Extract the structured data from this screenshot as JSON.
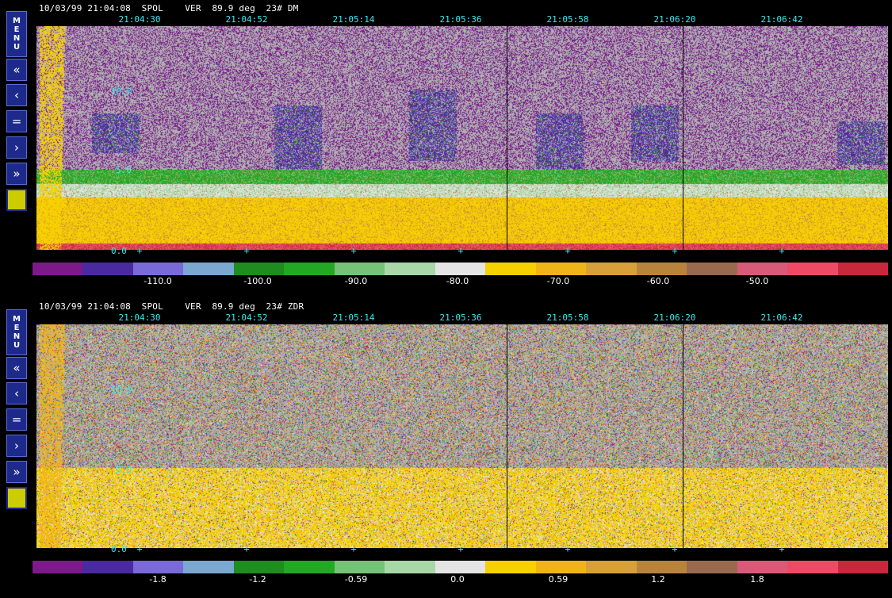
{
  "panels": [
    {
      "header": "10/03/99 21:04:08  SPOL    VER  89.9 deg  23# DM",
      "times": [
        "21:04:30",
        "21:04:52",
        "21:05:14",
        "21:05:36",
        "21:05:58",
        "21:06:20",
        "21:06:42"
      ],
      "alt_labels": [
        "10.0",
        "5.0"
      ],
      "zero_label": "0.0",
      "colorbar_labels": [
        "-110.0",
        "-100.0",
        "-90.0",
        "-80.0",
        "-70.0",
        "-60.0",
        "-50.0"
      ],
      "colorbar_colors": [
        "#7c1a8a",
        "#4a2aa0",
        "#7a6ad8",
        "#7aa8d0",
        "#1e8c1e",
        "#22a822",
        "#76c276",
        "#a8d8a8",
        "#e4e4e4",
        "#f7d000",
        "#f0b418",
        "#d8a038",
        "#b8843c",
        "#9a6a50",
        "#d85a78",
        "#ee4a66",
        "#c8283c"
      ],
      "field": "DM"
    },
    {
      "header": "10/03/99 21:04:08  SPOL    VER  89.9 deg  23# ZDR",
      "times": [
        "21:04:30",
        "21:04:52",
        "21:05:14",
        "21:05:36",
        "21:05:58",
        "21:06:20",
        "21:06:42"
      ],
      "alt_labels": [
        "10.0",
        "5.0"
      ],
      "zero_label": "0.0",
      "colorbar_labels": [
        "-1.8",
        "-1.2",
        "-0.59",
        "0.0",
        "0.59",
        "1.2",
        "1.8"
      ],
      "colorbar_colors": [
        "#7c1a8a",
        "#4a2aa0",
        "#7a6ad8",
        "#7aa8d0",
        "#1e8c1e",
        "#22a822",
        "#76c276",
        "#a8d8a8",
        "#e4e4e4",
        "#f7d000",
        "#f0b418",
        "#d8a038",
        "#b8843c",
        "#9a6a50",
        "#d85a78",
        "#ee4a66",
        "#c8283c"
      ],
      "field": "ZDR"
    }
  ],
  "sidebar": {
    "menu_label": [
      "M",
      "E",
      "N",
      "U"
    ],
    "buttons": [
      {
        "name": "fast-back-icon",
        "glyph": "«"
      },
      {
        "name": "back-icon",
        "glyph": "‹"
      },
      {
        "name": "stop-icon",
        "glyph": "="
      },
      {
        "name": "forward-icon",
        "glyph": "›"
      },
      {
        "name": "fast-forward-icon",
        "glyph": "»"
      },
      {
        "name": "color-swatch-icon",
        "glyph": ""
      }
    ]
  },
  "colors": {
    "background": "#000000",
    "accent": "#3ee8ee",
    "button": "#1d2a8c",
    "noise_gray": "#b0b0b0"
  }
}
